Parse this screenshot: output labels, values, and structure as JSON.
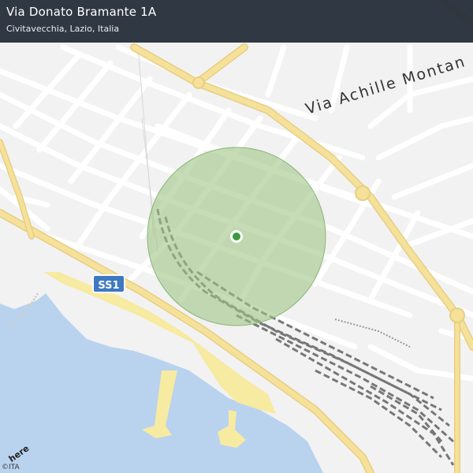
{
  "header": {
    "title": "Via Donato Bramante 1A",
    "subtitle": "Civitavecchia, Lazio, Italia"
  },
  "map": {
    "street_label": "Via Achille Montan",
    "road_shield": "SS1",
    "logo": "here",
    "copyright": "©ITA"
  },
  "colors": {
    "sea": "#b9d3ef",
    "beach": "#f7eaa1",
    "land": "#f2f2f2",
    "major_road": "#f6e19a",
    "accuracy_circle": "#9fc587",
    "location_dot": "#3c9a3c",
    "shield": "#3e79c2"
  }
}
